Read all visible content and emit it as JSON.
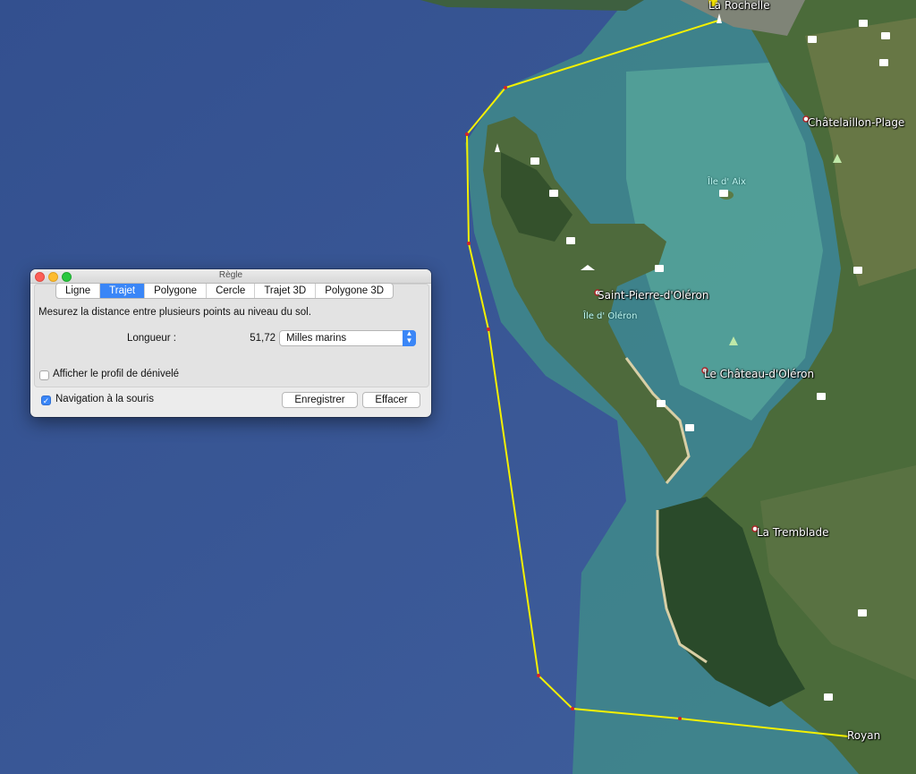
{
  "map": {
    "labels": {
      "la_rochelle": "La Rochelle",
      "chatelaillon": "Châtelaillon-Plage",
      "ile_aix": "Île d' Aix",
      "saint_pierre": "Saint-Pierre-d'Oléron",
      "ile_oleron": "Île d' Oléron",
      "chateau_oleron": "Le Château-d'Oléron",
      "la_tremblade": "La Tremblade",
      "royan": "Royan"
    },
    "path_color": "#f4f000",
    "ocean_color": "#3d5a98"
  },
  "dialog": {
    "title": "Règle",
    "tabs": [
      "Ligne",
      "Trajet",
      "Polygone",
      "Cercle",
      "Trajet 3D",
      "Polygone 3D"
    ],
    "active_tab": "Trajet",
    "description": "Mesurez la distance entre plusieurs points au niveau du sol.",
    "length_label": "Longueur :",
    "length_value": "51,72",
    "unit": "Milles marins",
    "profile_checkbox": "Afficher le profil de dénivelé",
    "profile_checked": false,
    "navigation_checkbox": "Navigation à la souris",
    "navigation_checked": true,
    "save_button": "Enregistrer",
    "clear_button": "Effacer"
  }
}
